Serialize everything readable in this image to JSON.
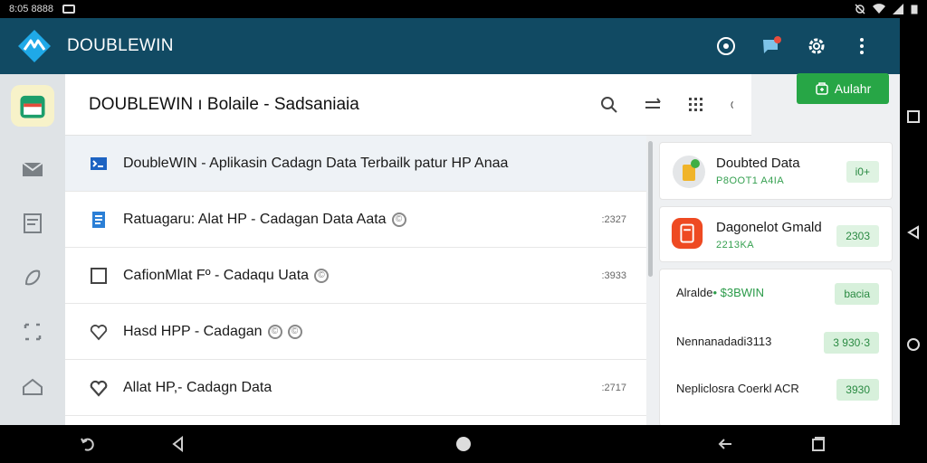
{
  "status_bar": {
    "time_left": "8:05 8888"
  },
  "app": {
    "title": "DOUBLEWIN",
    "accent": "#114a63",
    "green": "#27a646"
  },
  "header": {
    "title": "DOUBLEWIN ı Bolaile - Sadsaniaia"
  },
  "add_button": {
    "label": "Aulahr"
  },
  "list": [
    {
      "icon": "terminal-icon",
      "title": "DoubleWIN - Aplikasin Cadagn Data Terbailk patur HP Anaa",
      "meta": "",
      "badges": 0,
      "selected": true
    },
    {
      "icon": "document-icon",
      "title": "Ratuagaru: Alat HP - Cadagan Data Aata",
      "meta": ":2327",
      "badges": 1,
      "selected": false
    },
    {
      "icon": "checkbox-icon",
      "title": "CafionMlat Fº - Cadaqu Uata",
      "meta": ":3933",
      "badges": 1,
      "selected": false
    },
    {
      "icon": "heart-icon",
      "title": "Hasd HPP - Cadagan",
      "meta": "",
      "badges": 2,
      "selected": false
    },
    {
      "icon": "heart-outline-icon",
      "title": "Allat HP,- Cadagn Data",
      "meta": ":2717",
      "badges": 0,
      "selected": false
    }
  ],
  "cards": {
    "card1": {
      "title": "Doubted Data",
      "sub": "P8OOT1 A4IA",
      "badge": "i0+"
    },
    "card2": {
      "title": "Dagonelot Gmald",
      "sub": "2213KA",
      "badge": "2303"
    },
    "card3": {
      "rows": [
        {
          "label": "Alralde",
          "green": "• $3BWIN",
          "badge": "bacia"
        },
        {
          "label": "Nennanadadi3113",
          "green": "",
          "badge": "3 930·3"
        },
        {
          "label": "Nepliclosra Coerkl ACR",
          "green": "",
          "badge": "3930"
        }
      ]
    }
  }
}
